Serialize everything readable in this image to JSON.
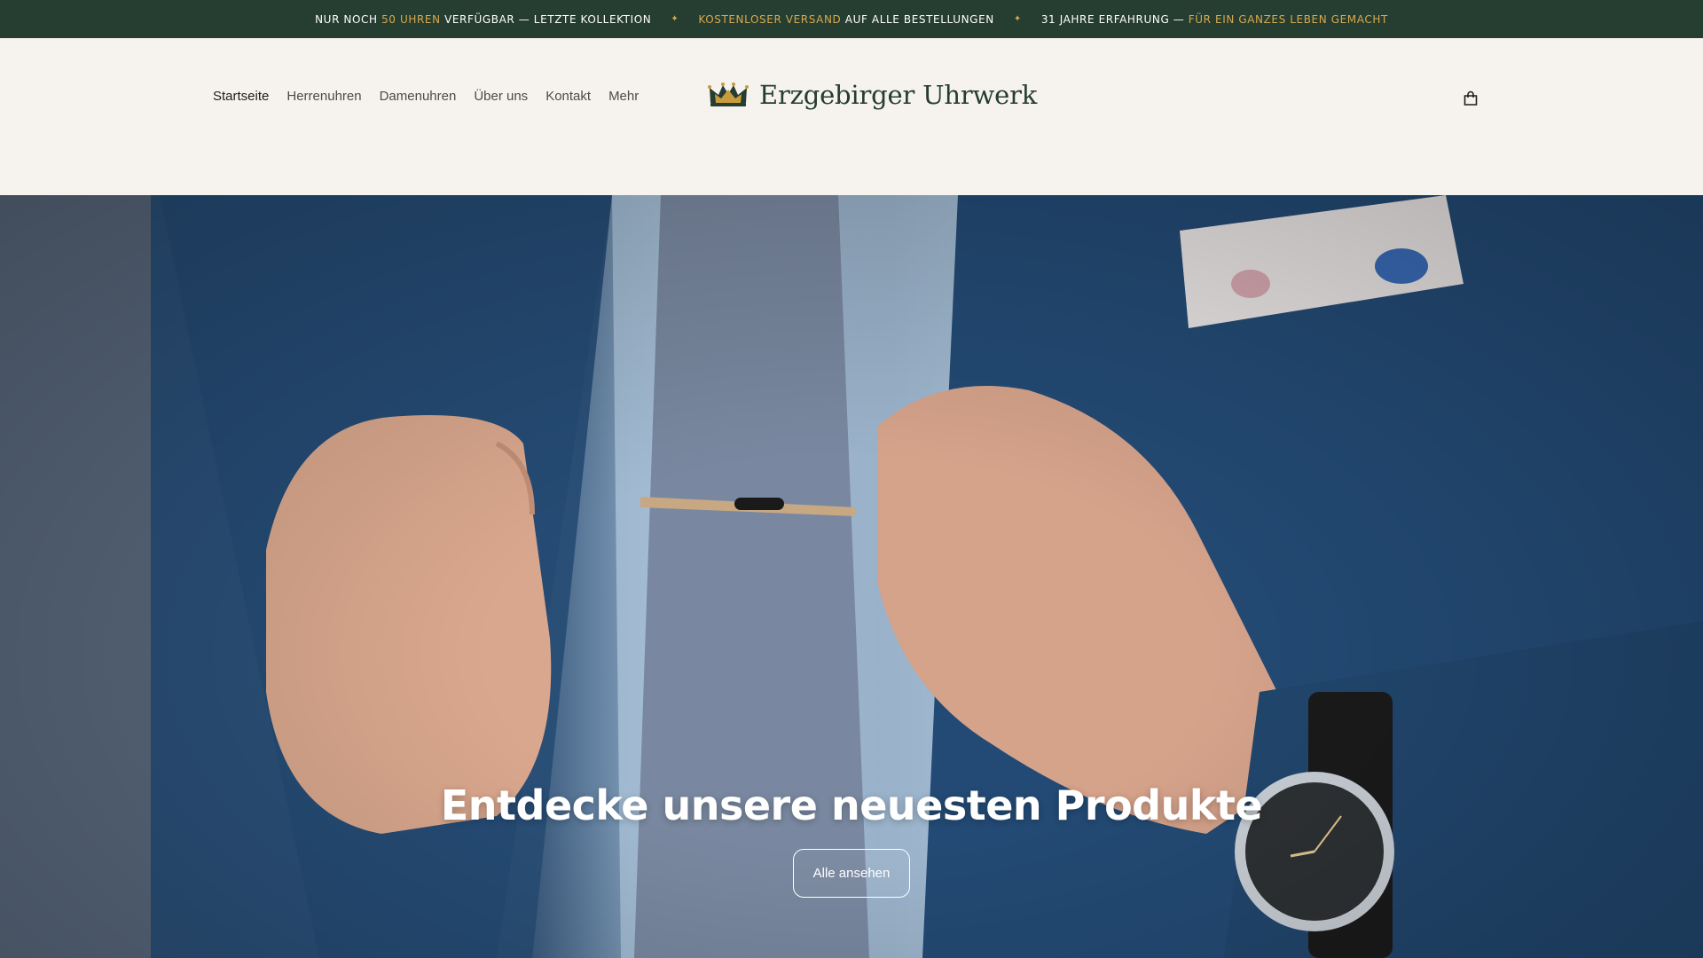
{
  "colors": {
    "announce_bg": "#263d31",
    "accent_gold": "#d6aa4e",
    "header_bg": "#f6f3ee",
    "brand_green": "#263d31"
  },
  "announcement": {
    "msg1": {
      "pre": "NUR NOCH ",
      "hl": "50 UHREN",
      "post": " VERFÜGBAR — LETZTE KOLLEKTION"
    },
    "msg2": {
      "hl": "KOSTENLOSER VERSAND",
      "post": " AUF ALLE BESTELLUNGEN"
    },
    "msg3": {
      "pre": "31 JAHRE ERFAHRUNG — ",
      "hl": "FÜR EIN GANZES LEBEN GEMACHT"
    },
    "separator": "✦"
  },
  "nav": {
    "items": [
      {
        "label": "Startseite",
        "active": true
      },
      {
        "label": "Herrenuhren"
      },
      {
        "label": "Damenuhren"
      },
      {
        "label": "Über uns"
      },
      {
        "label": "Kontakt"
      },
      {
        "label": "Mehr"
      }
    ]
  },
  "brand": {
    "name": "Erzgebirger Uhrwerk",
    "logo_icon": "crown-icon"
  },
  "header": {
    "cart_icon": "shopping-bag-icon"
  },
  "hero": {
    "title": "Entdecke unsere neuesten Produkte",
    "button_label": "Alle ansehen",
    "image_subject": "photo-of-suit-tie-clip-and-watch"
  }
}
